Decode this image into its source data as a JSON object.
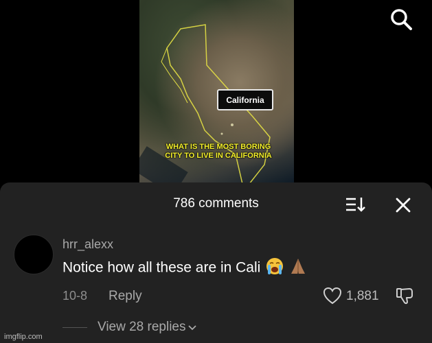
{
  "video": {
    "map_label": "California",
    "caption_line1": "WHAT IS THE MOST BORING",
    "caption_line2": "CITY TO LIVE IN CALIFORNIA"
  },
  "icons": {
    "search": "search-icon",
    "sort": "sort-icon",
    "close": "close-icon",
    "like": "heart-icon",
    "dislike": "thumbs-down-icon",
    "chevron": "chevron-down-icon"
  },
  "comments_panel": {
    "title": "786 comments"
  },
  "comment": {
    "username": "hrr_alexx",
    "text": "Notice how all these are in Cali",
    "emojis": [
      "crying-face",
      "folded-hands"
    ],
    "date": "10-8",
    "reply_label": "Reply",
    "like_count": "1,881",
    "view_replies": "View 28 replies"
  },
  "watermark": "imgflip.com",
  "colors": {
    "background": "#000000",
    "sheet": "#222222",
    "caption": "#f4f02a",
    "muted_text": "#a9a9a9"
  }
}
